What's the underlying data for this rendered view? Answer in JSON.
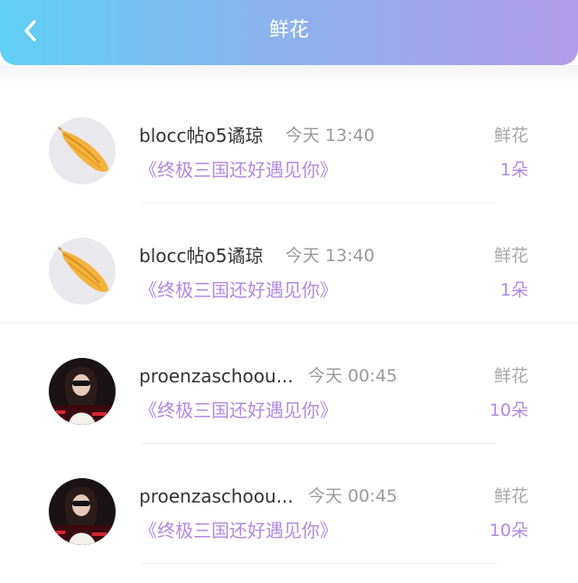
{
  "header": {
    "title": "鲜花",
    "back_icon": "chevron-left-icon",
    "gradient": [
      "#5fd0f4",
      "#b29be8"
    ]
  },
  "items": [
    {
      "name": "blocc帖o5谲琼",
      "time": "今天 13:40",
      "book": "《终极三国还好遇见你》",
      "gift": "鲜花",
      "count": "1朵",
      "avatar": "shell-avatar"
    },
    {
      "name": "blocc帖o5谲琼",
      "time": "今天 13:40",
      "book": "《终极三国还好遇见你》",
      "gift": "鲜花",
      "count": "1朵",
      "avatar": "shell-avatar"
    },
    {
      "name": "proenzaschoou...",
      "time": "今天 00:45",
      "book": "《终极三国还好遇见你》",
      "gift": "鲜花",
      "count": "10朵",
      "avatar": "person-avatar"
    },
    {
      "name": "proenzaschoou...",
      "time": "今天 00:45",
      "book": "《终极三国还好遇见你》",
      "gift": "鲜花",
      "count": "10朵",
      "avatar": "person-avatar"
    }
  ]
}
